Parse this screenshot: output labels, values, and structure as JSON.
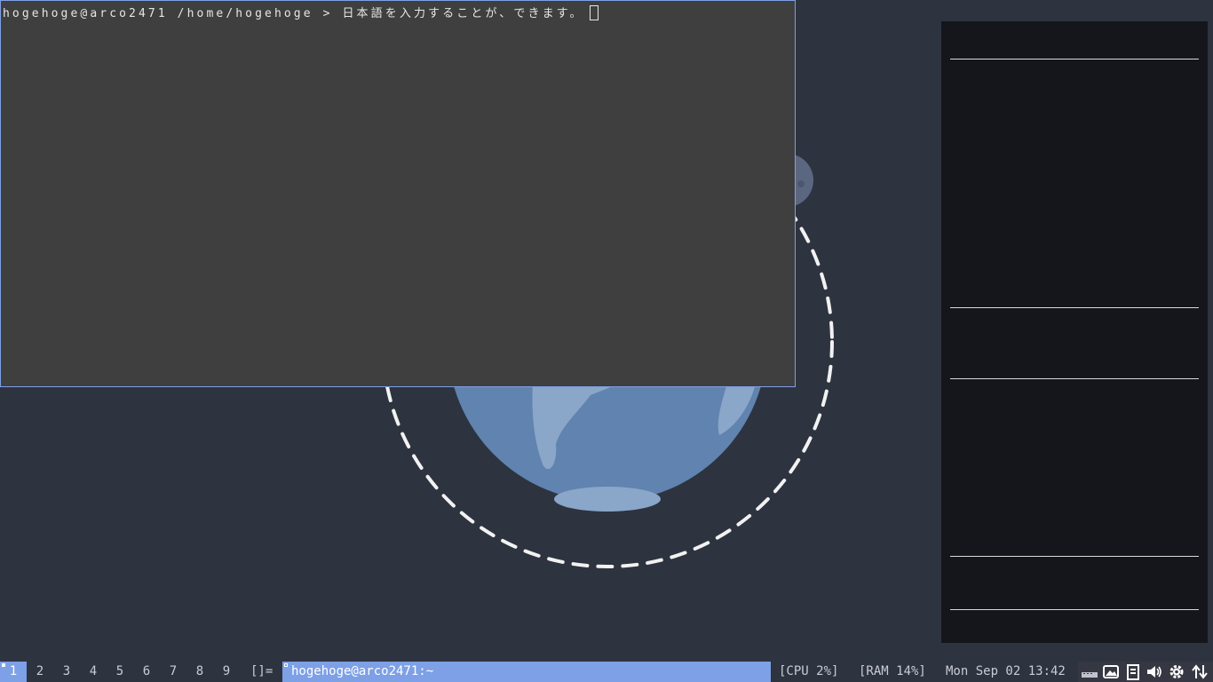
{
  "terminal": {
    "prompt": "hogehoge@arco2471 /home/hogehoge > ",
    "input": "日本語を入力することが、できます。"
  },
  "bar": {
    "tags": [
      "1",
      "2",
      "3",
      "4",
      "5",
      "6",
      "7",
      "8",
      "9"
    ],
    "active_tag": "1",
    "layout_symbol": "[]=",
    "window_title": "hogehoge@arco2471:~",
    "cpu": "[CPU 2%]",
    "ram": "[RAM 14%]",
    "datetime": "Mon Sep 02 13:42"
  },
  "tray_icons": [
    "keyboard-icon",
    "image-viewer-icon",
    "clipboard-icon",
    "volume-icon",
    "settings-gear-icon",
    "network-transfer-icon"
  ],
  "colors": {
    "accent": "#7da0e6",
    "desktop_bg": "#2e3340",
    "terminal_bg": "#3f3f3f",
    "panel_bg": "#15161b",
    "earth": "#6083b0"
  }
}
